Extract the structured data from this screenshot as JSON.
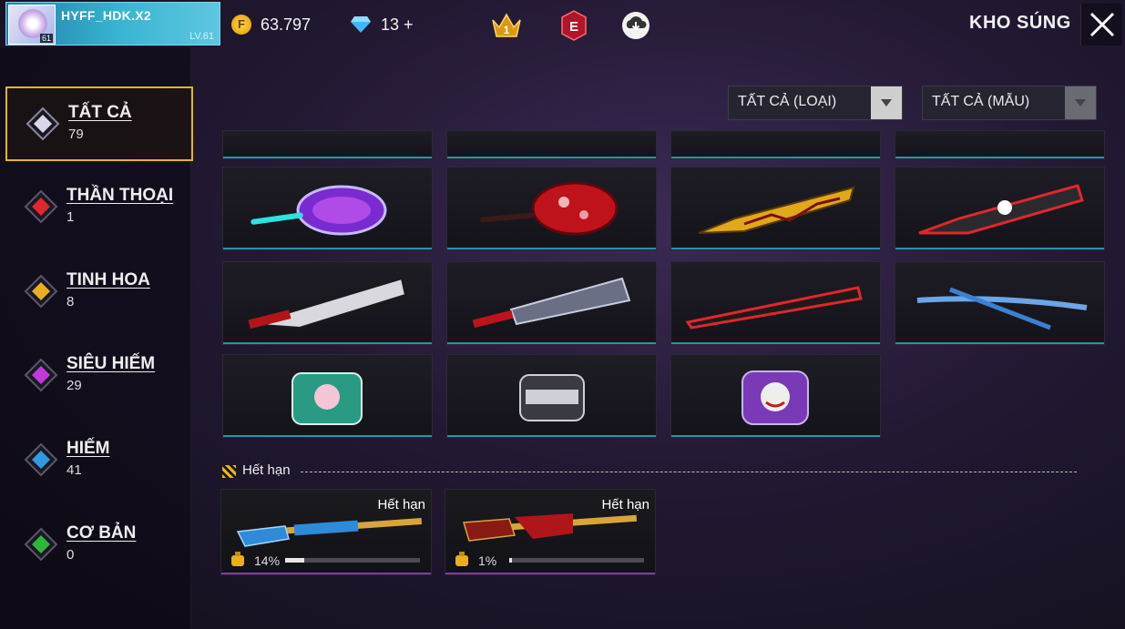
{
  "header": {
    "player_name": "HYFF_HDK.X2",
    "avatar_level": "61",
    "level_text": "LV.61",
    "coins": "63.797",
    "diamonds": "13",
    "diamond_plus": "+",
    "rank_badge": "1",
    "elite_badge": "E",
    "title": "KHO SÚNG"
  },
  "sidebar": {
    "items": [
      {
        "label": "TẤT CẢ",
        "count": "79",
        "color": "#d8d8e8",
        "active": true
      },
      {
        "label": "THẦN THOẠI",
        "count": "1",
        "color": "#e0262e"
      },
      {
        "label": "TINH HOA",
        "count": "8",
        "color": "#e8b020"
      },
      {
        "label": "SIÊU HIẾM",
        "count": "29",
        "color": "#c13ad8"
      },
      {
        "label": "HIẾM",
        "count": "41",
        "color": "#2f9be0"
      },
      {
        "label": "CƠ BẢN",
        "count": "0",
        "color": "#2fb838"
      }
    ]
  },
  "filters": {
    "type_label": "TẤT CẢ (LOẠI)",
    "skin_label": "TẤT CẢ (MẪU)"
  },
  "grid": {
    "items": [
      {
        "icon": "pan-purple-icon"
      },
      {
        "icon": "pan-red-icon"
      },
      {
        "icon": "machete-gold-icon"
      },
      {
        "icon": "machete-red-icon"
      },
      {
        "icon": "machete-white-icon"
      },
      {
        "icon": "cleaver-icon"
      },
      {
        "icon": "bat-red-icon"
      },
      {
        "icon": "katana-blue-icon"
      },
      {
        "icon": "gloo-wall-bunny-icon"
      },
      {
        "icon": "gloo-wall-mvp-icon"
      },
      {
        "icon": "gloo-wall-joker-icon"
      }
    ]
  },
  "expired": {
    "section_label": "Hết hạn",
    "items": [
      {
        "tag": "Hết hạn",
        "percent_text": "14%",
        "progress": 0.14,
        "icon": "shotgun-blue-icon"
      },
      {
        "tag": "Hết hạn",
        "percent_text": "1%",
        "progress": 0.01,
        "icon": "shotgun-red-icon"
      }
    ]
  }
}
